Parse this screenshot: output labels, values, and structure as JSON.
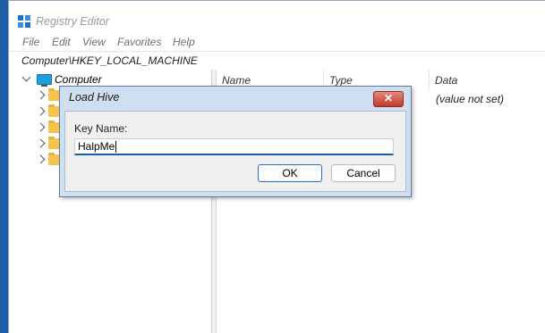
{
  "window": {
    "title": "Registry Editor"
  },
  "menu": [
    "File",
    "Edit",
    "View",
    "Favorites",
    "Help"
  ],
  "address": "Computer\\HKEY_LOCAL_MACHINE",
  "tree": {
    "root_label": "Computer",
    "child_count": 5
  },
  "list": {
    "columns": [
      "Name",
      "Type",
      "Data"
    ],
    "rows": [
      {
        "data": "(value not set)"
      }
    ]
  },
  "dialog": {
    "title": "Load Hive",
    "close_glyph": "✕",
    "label": "Key Name:",
    "value": "HalpMe",
    "ok_label": "OK",
    "cancel_label": "Cancel"
  },
  "colors": {
    "accent": "#1a5fa9",
    "close_button": "#c0392b",
    "dialog_frame": "#cfdff0"
  },
  "icons": [
    "registry-icon",
    "computer-icon",
    "folder-icon",
    "chevron-icon",
    "close-icon"
  ]
}
